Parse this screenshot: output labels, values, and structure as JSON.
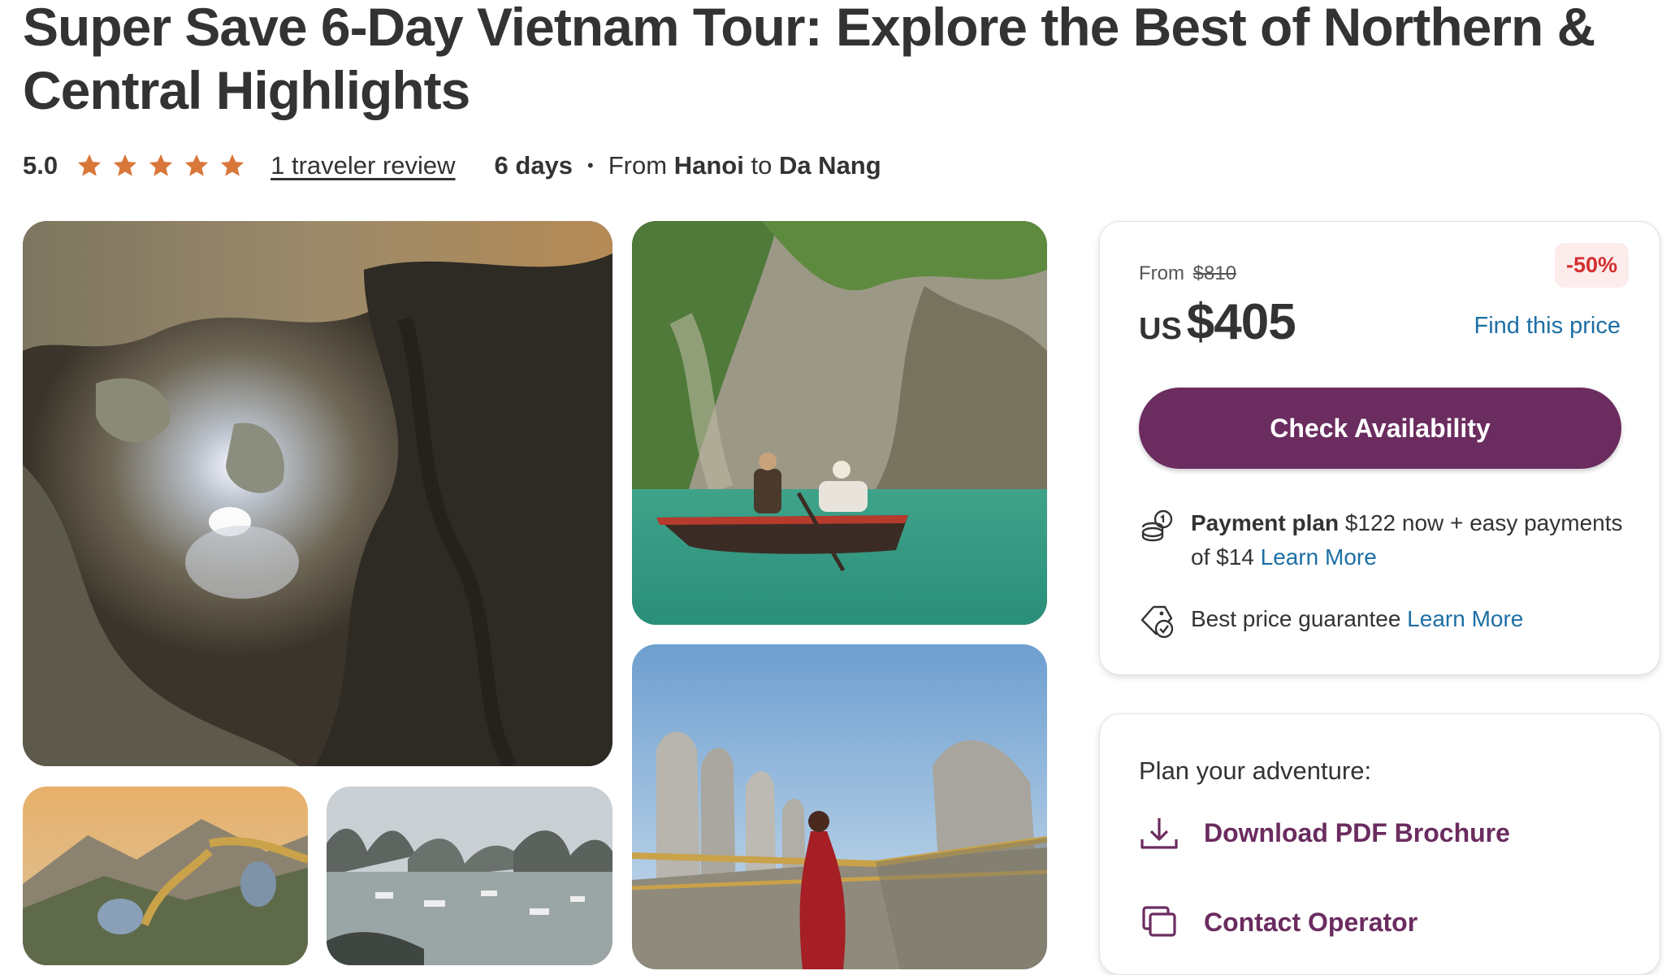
{
  "tour": {
    "title": "Super Save 6-Day Vietnam Tour: Explore the Best of Northern & Central Highlights",
    "rating": "5.0",
    "stars": 5,
    "review_link": "1 traveler review",
    "duration": "6 days",
    "dot": "•",
    "route_from_prefix": "From",
    "route_start": "Hanoi",
    "route_mid": "to",
    "route_end": "Da Nang"
  },
  "price_card": {
    "from_label": "From",
    "old_price": "$810",
    "discount": "-50%",
    "currency": "US",
    "price": "$405",
    "find_price": "Find this price",
    "cta": "Check Availability",
    "payment_label": "Payment plan",
    "payment_text": "$122 now + easy payments of $14",
    "payment_learn": "Learn More",
    "guarantee_text": "Best price guarantee",
    "guarantee_learn": "Learn More"
  },
  "plan_card": {
    "title": "Plan your adventure:",
    "download": "Download PDF Brochure",
    "contact": "Contact Operator"
  },
  "colors": {
    "star": "#d9773a",
    "cta": "#6b2c5f",
    "link": "#1d6fa5",
    "discount": "#d32f2f"
  },
  "icons": [
    "star-icon",
    "coins-icon",
    "badge-check-icon",
    "download-icon",
    "message-icon"
  ]
}
